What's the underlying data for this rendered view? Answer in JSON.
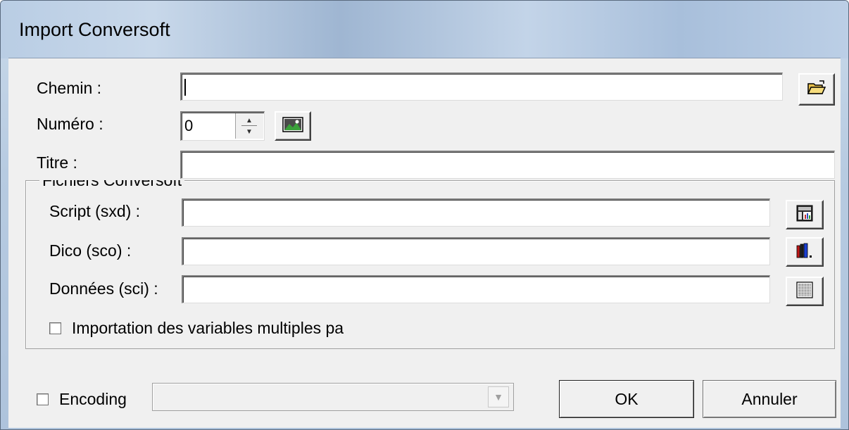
{
  "window": {
    "title": "Import Conversoft"
  },
  "fields": {
    "chemin": {
      "label": "Chemin :",
      "value": ""
    },
    "numero": {
      "label": "Numéro :",
      "value": "0"
    },
    "titre": {
      "label": "Titre :",
      "value": ""
    }
  },
  "group": {
    "title": "Fichiers Conversoft",
    "script": {
      "label": "Script (sxd) :",
      "value": ""
    },
    "dico": {
      "label": "Dico (sco) :",
      "value": ""
    },
    "donnees": {
      "label": "Données (sci) :",
      "value": ""
    },
    "multi_checkbox_label": "Importation des variables multiples pa"
  },
  "footer": {
    "encoding_label": "Encoding",
    "encoding_value": "",
    "ok_label": "OK",
    "cancel_label": "Annuler"
  },
  "icons": {
    "browse": "open-folder-icon",
    "preview": "image-preview-icon",
    "script": "script-table-icon",
    "dico": "books-icon",
    "donnees": "data-grid-icon"
  }
}
